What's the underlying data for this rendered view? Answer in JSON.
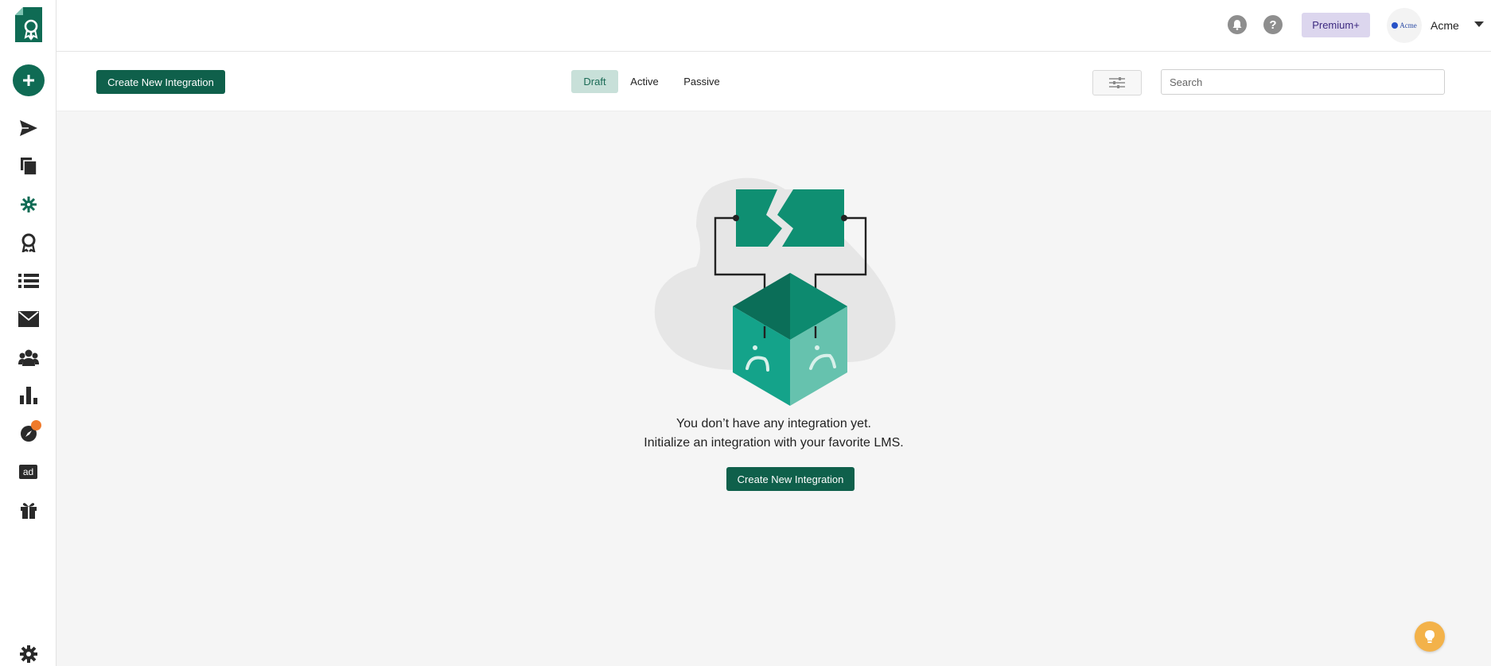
{
  "sidebar": {
    "items": [
      {
        "name": "logo",
        "icon": "certificate-logo-icon"
      },
      {
        "name": "create",
        "icon": "plus-icon"
      },
      {
        "name": "send",
        "icon": "send-icon"
      },
      {
        "name": "documents",
        "icon": "copy-icon"
      },
      {
        "name": "integrations",
        "icon": "integration-icon",
        "active": true
      },
      {
        "name": "badges",
        "icon": "award-icon"
      },
      {
        "name": "lists",
        "icon": "list-icon"
      },
      {
        "name": "email",
        "icon": "envelope-icon"
      },
      {
        "name": "recipients",
        "icon": "users-icon"
      },
      {
        "name": "analytics",
        "icon": "bar-chart-icon"
      },
      {
        "name": "explore",
        "icon": "compass-icon"
      },
      {
        "name": "ads",
        "icon": "ad-icon",
        "label": "ad"
      },
      {
        "name": "rewards",
        "icon": "gift-icon"
      },
      {
        "name": "settings",
        "icon": "gear-icon"
      }
    ]
  },
  "header": {
    "premium_label": "Premium+",
    "avatar_text": "Acme",
    "account_name": "Acme"
  },
  "toolbar": {
    "create_label": "Create New Integration",
    "tabs": [
      {
        "label": "Draft",
        "active": true
      },
      {
        "label": "Active",
        "active": false
      },
      {
        "label": "Passive",
        "active": false
      }
    ],
    "search_placeholder": "Search"
  },
  "empty_state": {
    "line1": "You don’t have any integration yet.",
    "line2": "Initialize an integration with your favorite LMS.",
    "button_label": "Create New Integration"
  },
  "colors": {
    "brand": "#0f604b",
    "accent_teal": "#14a38a",
    "tab_active_bg": "#c8e0d9",
    "premium_bg": "#dcd6ee",
    "notification_dot": "#f07b2c",
    "help_fab": "#f3b24a"
  }
}
